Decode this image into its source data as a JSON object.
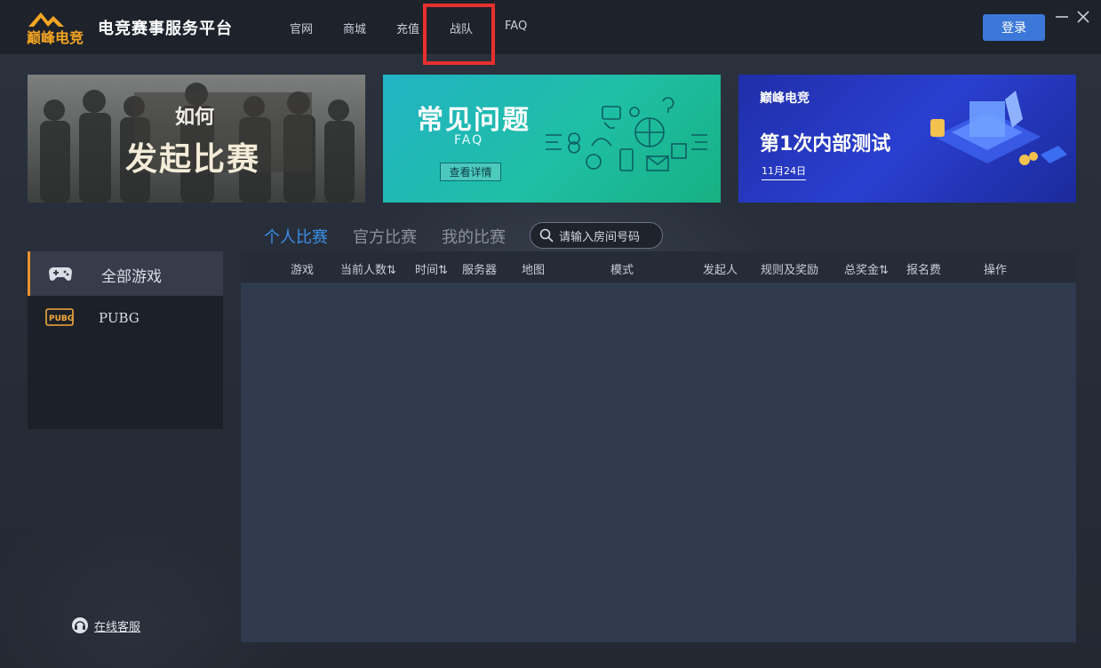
{
  "app": {
    "logo_text": "巅峰电竞",
    "title": "电竞赛事服务平台",
    "login_label": "登录"
  },
  "nav": {
    "items": [
      "官网",
      "商城",
      "充值",
      "战队",
      "FAQ"
    ]
  },
  "banners": {
    "b1_line1": "如何",
    "b1_line2": "发起比赛",
    "b2_title": "常见问题",
    "b2_sub": "FAQ",
    "b2_button": "查看详情",
    "b3_brand": "巅峰电竞",
    "b3_title": "第1次内部测试",
    "b3_date": "11月24日"
  },
  "tabs": {
    "items": [
      "个人比赛",
      "官方比赛",
      "我的比赛"
    ],
    "active_color": "#3a8ee6"
  },
  "search": {
    "placeholder": "请输入房间号码"
  },
  "sidebar": {
    "items": [
      {
        "label": "全部游戏",
        "icon": "gamepad-icon"
      },
      {
        "label": "PUBG",
        "icon": "pubg-logo-icon"
      }
    ]
  },
  "table": {
    "columns": [
      "游戏",
      "当前人数⇅",
      "时间⇅",
      "服务器",
      "地图",
      "模式",
      "发起人",
      "规则及奖励",
      "总奖金⇅",
      "报名费",
      "操作"
    ]
  },
  "support": {
    "label": "在线客服"
  }
}
